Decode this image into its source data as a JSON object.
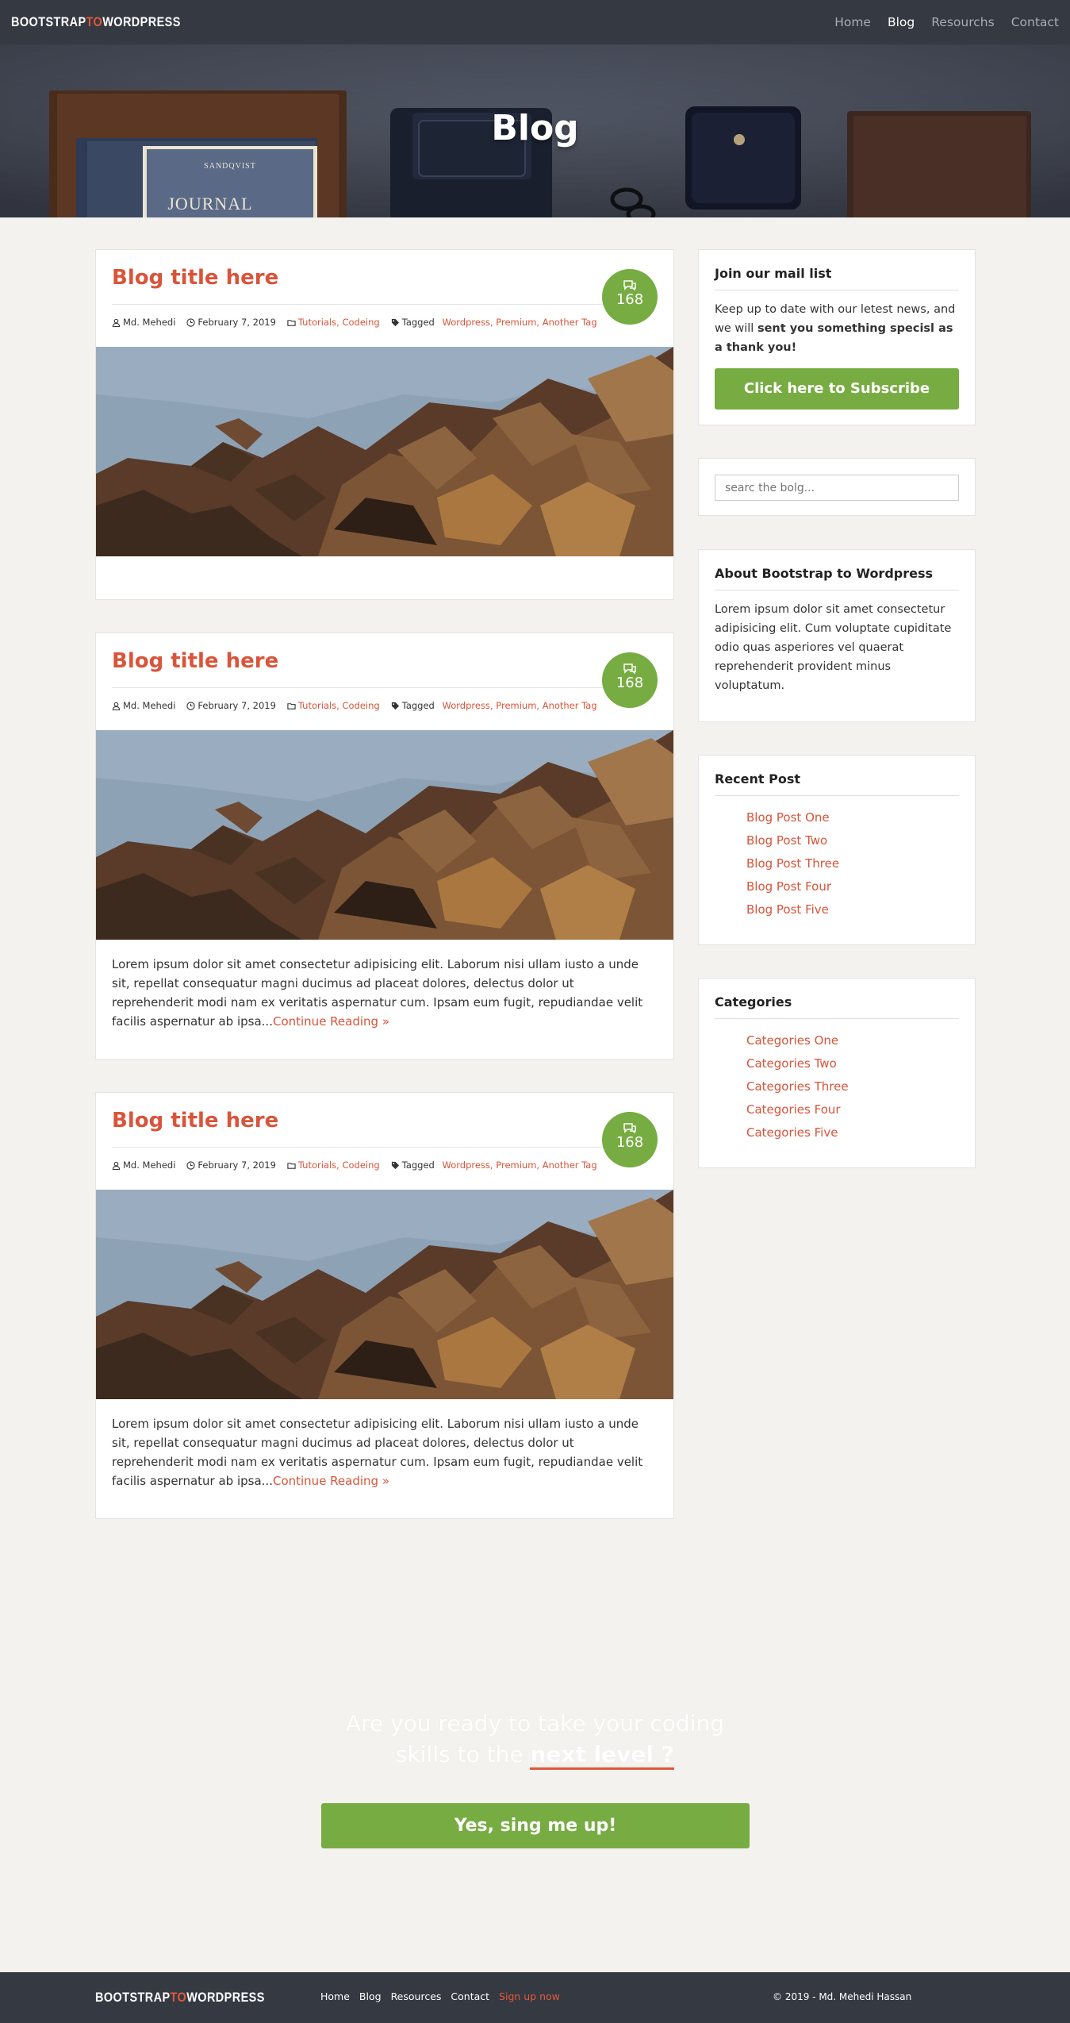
{
  "nav": {
    "brand_part1": "BOOTSTRAP",
    "brand_to": "TO",
    "brand_part2": "WORDPRESS",
    "links": [
      "Home",
      "Blog",
      "Resourchs",
      "Contact"
    ],
    "active": "Blog"
  },
  "hero": {
    "title": "Blog",
    "journal_top": "SANDQVIST",
    "journal_title": "JOURNAL"
  },
  "posts": [
    {
      "title": "Blog title here",
      "comments": "168",
      "author": "Md. Mehedi",
      "date": "February 7, 2019",
      "categories": "Tutorials, Codeing",
      "tagged_label": "Tagged",
      "tags": "Wordpress, Premium, Another Tag",
      "excerpt": "",
      "more": ""
    },
    {
      "title": "Blog title here",
      "comments": "168",
      "author": "Md. Mehedi",
      "date": "February 7, 2019",
      "categories": "Tutorials, Codeing",
      "tagged_label": "Tagged",
      "tags": "Wordpress, Premium, Another Tag",
      "excerpt": "Lorem ipsum dolor sit amet consectetur adipisicing elit. Laborum nisi ullam iusto a unde sit, repellat consequatur magni ducimus ad placeat dolores, delectus dolor ut reprehenderit modi nam ex veritatis aspernatur cum. Ipsam eum fugit, repudiandae velit facilis aspernatur ab ipsa...",
      "more": "Continue Reading »"
    },
    {
      "title": "Blog title here",
      "comments": "168",
      "author": "Md. Mehedi",
      "date": "February 7, 2019",
      "categories": "Tutorials, Codeing",
      "tagged_label": "Tagged",
      "tags": "Wordpress, Premium, Another Tag",
      "excerpt": "Lorem ipsum dolor sit amet consectetur adipisicing elit. Laborum nisi ullam iusto a unde sit, repellat consequatur magni ducimus ad placeat dolores, delectus dolor ut reprehenderit modi nam ex veritatis aspernatur cum. Ipsam eum fugit, repudiandae velit facilis aspernatur ab ipsa...",
      "more": "Continue Reading »"
    }
  ],
  "sidebar": {
    "mail": {
      "title": "Join our mail list",
      "text": "Keep up to date with our letest news, and we will ",
      "text_bold": "sent you something specisl as a thank you!",
      "button": "Click here to Subscribe"
    },
    "search": {
      "placeholder": "searc the bolg..."
    },
    "about": {
      "title": "About Bootstrap to Wordpress",
      "text": "Lorem ipsum dolor sit amet consectetur adipisicing elit. Cum voluptate cupiditate odio quas asperiores vel quaerat reprehenderit provident minus voluptatum."
    },
    "recent": {
      "title": "Recent Post",
      "items": [
        "Blog Post One",
        "Blog Post Two",
        "Blog Post Three",
        "Blog Post Four",
        "Blog Post Five"
      ]
    },
    "categories": {
      "title": "Categories",
      "items": [
        "Categories One",
        "Categories Two",
        "Categories Three",
        "Categories Four",
        "Categories Five"
      ]
    }
  },
  "cta": {
    "line1": "Are you ready to take your coding",
    "line2": "skills to the ",
    "highlight": "next level ?",
    "button": "Yes, sing me up!"
  },
  "footer": {
    "links": [
      "Home",
      "Blog",
      "Resources",
      "Contact"
    ],
    "signup": "Sign up now",
    "copyright": "© 2019 - Md. Mehedi Hassan"
  },
  "colors": {
    "accent": "#d8543a",
    "green": "#76ac41",
    "dark": "#353a42"
  }
}
